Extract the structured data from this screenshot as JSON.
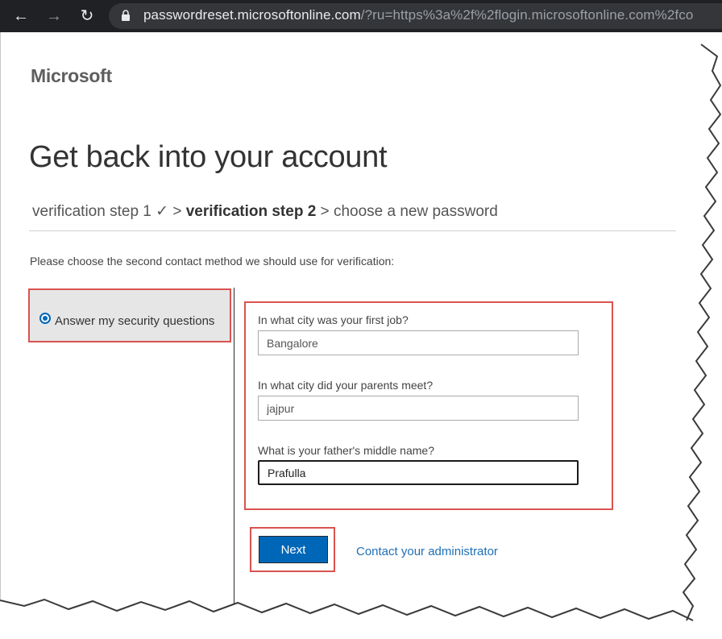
{
  "browser": {
    "back_icon": "arrow-left-icon",
    "forward_icon": "arrow-right-icon",
    "reload_icon": "reload-icon",
    "lock_icon": "lock-icon",
    "url_host": "passwordreset.microsoftonline.com",
    "url_path": "/?ru=https%3a%2f%2flogin.microsoftonline.com%2fco"
  },
  "header": {
    "logo": "Microsoft",
    "title": "Get back into your account"
  },
  "steps": {
    "step1": "verification step 1 ✓",
    "sep1": " > ",
    "step2": "verification step 2",
    "sep2": " > ",
    "step3": "choose a new password"
  },
  "instruction": "Please choose the second contact method we should use for verification:",
  "method": {
    "label": "Answer my security questions",
    "selected": true
  },
  "questions": [
    {
      "label": "In what city was your first job?",
      "value": "Bangalore"
    },
    {
      "label": "In what city did your parents meet?",
      "value": "jajpur"
    },
    {
      "label": "What is your father's middle name?",
      "value": "Prafulla"
    }
  ],
  "actions": {
    "next_label": "Next",
    "contact_admin_label": "Contact your administrator"
  },
  "colors": {
    "accent": "#0067b8",
    "highlight_border": "#d9534f",
    "link": "#1f6fb5"
  }
}
